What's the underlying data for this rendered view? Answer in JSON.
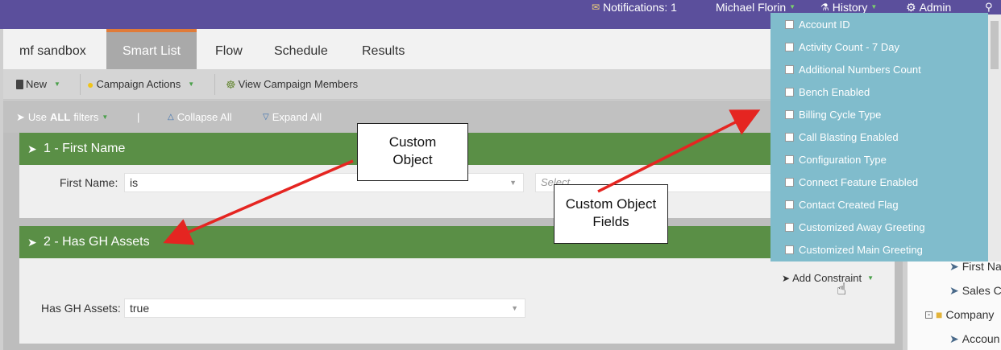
{
  "topbar": {
    "notifications": "Notifications: 1",
    "user": "Michael Florin",
    "history": "History",
    "admin": "Admin"
  },
  "tabs": [
    {
      "label": "mf sandbox"
    },
    {
      "label": "Smart List"
    },
    {
      "label": "Flow"
    },
    {
      "label": "Schedule"
    },
    {
      "label": "Results"
    }
  ],
  "toolbar": {
    "new_label": "New",
    "campaign_actions_label": "Campaign Actions",
    "view_members_label": "View Campaign Members"
  },
  "filterbar": {
    "use_prefix": "Use",
    "use_bold": "ALL",
    "use_suffix": "filters",
    "divider": "|",
    "collapse_label": "Collapse All",
    "expand_label": "Expand All"
  },
  "filters": [
    {
      "title": "1 - First Name",
      "field_label": "First Name:",
      "operator": "is",
      "value_placeholder": "Select..."
    },
    {
      "title": "2 - Has GH Assets",
      "field_label": "Has GH Assets:",
      "value": "true",
      "add_constraint_label": "Add Constraint"
    }
  ],
  "tree": {
    "items": [
      "First Na",
      "Sales C",
      "Company",
      "Accoun"
    ]
  },
  "dropdown": {
    "items": [
      "Account ID",
      "Activity Count - 7 Day",
      "Additional Numbers Count",
      "Bench Enabled",
      "Billing Cycle Type",
      "Call Blasting Enabled",
      "Configuration Type",
      "Connect Feature Enabled",
      "Contact Created Flag",
      "Customized Away Greeting",
      "Customized Main Greeting"
    ]
  },
  "annotations": {
    "custom_object_line1": "Custom",
    "custom_object_line2": "Object",
    "custom_fields_line1": "Custom Object",
    "custom_fields_line2": "Fields"
  },
  "colors": {
    "topbar": "#5b4f9c",
    "filter_header": "#5a8f46",
    "dropdown_bg": "#80bccc",
    "arrow": "#e52521",
    "active_tab_accent": "#e07b39"
  },
  "icons": [
    "bell-icon",
    "gear-icon",
    "history-icon",
    "new-icon",
    "lightbulb-icon",
    "people-icon",
    "funnel-icon",
    "triangle-up-icon",
    "triangle-down-icon",
    "wrench-icon",
    "folder-icon",
    "hand-cursor-icon"
  ]
}
